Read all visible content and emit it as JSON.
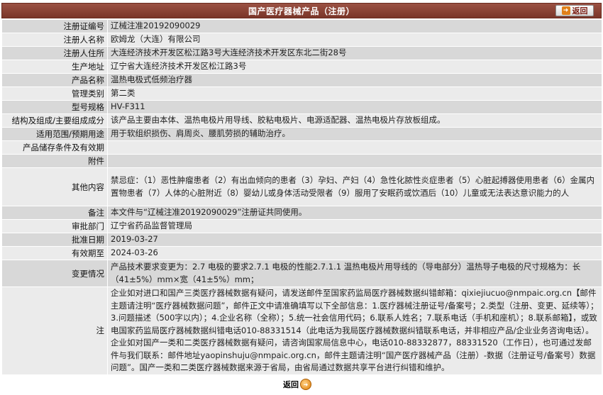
{
  "header": {
    "title": "国产医疗器械产品（注册）",
    "back_label": "返回"
  },
  "rows": [
    {
      "label": "注册证编号",
      "value": "辽械注准20192090029"
    },
    {
      "label": "注册人名称",
      "value": "欧姆龙（大连）有限公司"
    },
    {
      "label": "注册人住所",
      "value": "大连经济技术开发区松江路3号大连经济技术开发区东北二街28号"
    },
    {
      "label": "生产地址",
      "value": "辽宁省大连经济技术开发区松江路3号"
    },
    {
      "label": "产品名称",
      "value": "温热电极式低频治疗器"
    },
    {
      "label": "管理类别",
      "value": "第二类"
    },
    {
      "label": "型号规格",
      "value": "HV-F311"
    },
    {
      "label": "结构及组成/主要组成成分",
      "value": "该产品主要由本体、温热电极片用导线、胶粘电极片、电源适配器、温热电极片存放板组成。"
    },
    {
      "label": "适用范围/预期用途",
      "value": "用于软组织损伤、肩周炎、腰肌劳损的辅助治疗。"
    },
    {
      "label": "产品储存条件及有效期",
      "value": ""
    },
    {
      "label": "附件",
      "value": ""
    },
    {
      "label": "其他内容",
      "value": "禁忌症：（1）恶性肿瘤患者（2）有出血倾向的患者（3）孕妇、产妇（4）急性化脓性炎症患者（5）心脏起搏器使用患者（6）金属内置物患者（7）人体的心脏附近（8）婴幼儿或身体活动受限者（9）服用了安眠药或饮酒后（10）儿童或无法表达意识能力的人"
    },
    {
      "label": "备注",
      "value": "本文件与“辽械注准20192090029”注册证共同使用。"
    },
    {
      "label": "审批部门",
      "value": "辽宁省药品监督管理局"
    },
    {
      "label": "批准日期",
      "value": "2019-03-27"
    },
    {
      "label": "有效期至",
      "value": "2024-03-26"
    },
    {
      "label": "变更情况",
      "value": "产品技术要求变更为：2.7 电极的要求2.7.1 电极的性能2.7.1.1 温热电极片用导线的（导电部分）温热导子电极的尺寸规格为：长（41±5%）mm×宽（41±5%）mm；"
    },
    {
      "label": "注",
      "value": "企业如对进口和国产三类医疗器械数据有疑问，请发送邮件至国家药监局医疗器械数据纠错邮箱：qixiejiucuo@nmpaic.org.cn【邮件主题请注明“医疗器械数据问题”，邮件正文中请准确填写以下全部信息：1.医疗器械注册证号/备案号；2.类型（注册、变更、延续等）；3.问题描述（500字以内）；4.企业名称（全称）；5.统一社会信用代码；6.联系人姓名；7.联系电话（手机和座机）；8.联系邮箱】，或致电国家药监局医疗器械数据纠错电话010-88331514（此电话为我局医疗器械数据纠错联系电话，并非相应产品/企业业务咨询电话）。企业如对国产一类和二类医疗器械数据有疑问，请咨询国家局信息中心，电话010-88332877，88331520（工作日），也可通过发邮件与我们联系：邮件地址yaopinshuju@nmpaic.org.cn，邮件主题请注明“国产医疗器械产品（注册）-数据（注册证号/备案号）数据问题”。国产一类和二类医疗器械数据来源于省局，由省局通过数据共享平台进行纠错和维护。"
    }
  ],
  "footer": {
    "back_label": "返回"
  }
}
